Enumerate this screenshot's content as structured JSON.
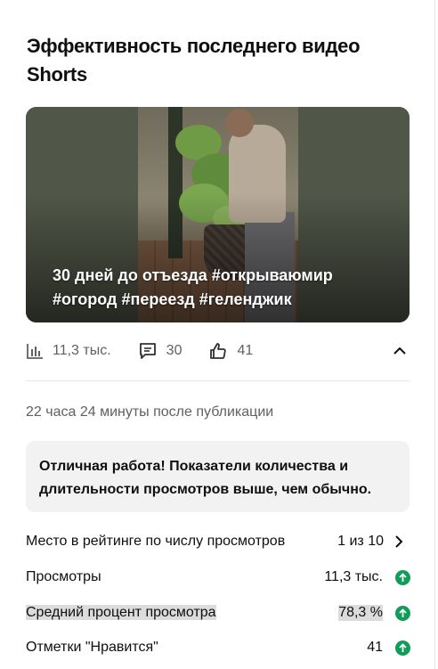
{
  "header": {
    "title": "Эффективность последнего видео Shorts"
  },
  "video": {
    "title": "30 дней до отъезда #открываюмир #огород #переезд #геленджик"
  },
  "stats": {
    "views": "11,3 тыс.",
    "comments": "30",
    "likes": "41",
    "views_icon": "bar-chart-icon",
    "comments_icon": "comment-icon",
    "likes_icon": "thumbs-up-icon",
    "collapse_icon": "chevron-up-icon"
  },
  "elapsed": "22 часа 24 минуты после публикации",
  "notice": "Отличная работа! Показатели количества и длительности просмотров выше, чем обычно.",
  "metrics": [
    {
      "label": "Место в рейтинге по числу просмотров",
      "value": "1 из 10",
      "icon": "chevron-right-icon"
    },
    {
      "label": "Просмотры",
      "value": "11,3 тыс.",
      "icon": "arrow-up-circle-icon"
    },
    {
      "label": "Средний процент просмотра",
      "value": "78,3 %",
      "icon": "arrow-up-circle-icon"
    },
    {
      "label": "Отметки \"Нравится\"",
      "value": "41",
      "icon": "arrow-up-circle-icon"
    }
  ],
  "colors": {
    "accent_up": "#0f9d58",
    "notice_bg": "#f2f2f2",
    "secondary_text": "#606060"
  }
}
